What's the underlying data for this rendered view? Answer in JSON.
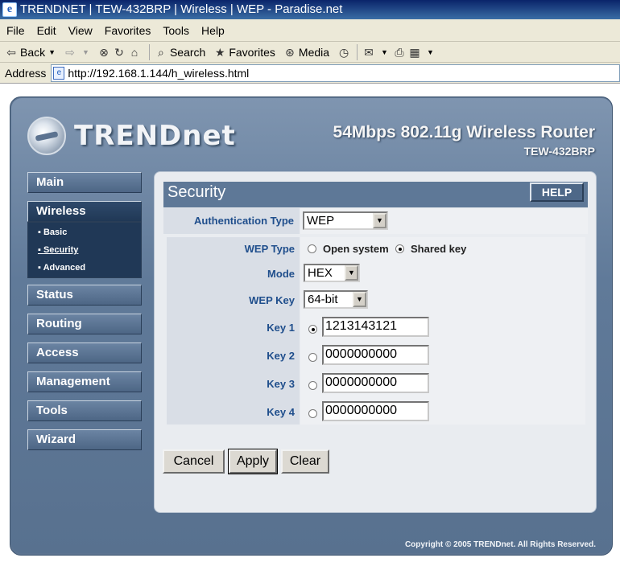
{
  "window": {
    "title": "TRENDNET | TEW-432BRP | Wireless | WEP - Paradise.net",
    "icon": "ie-icon"
  },
  "menu": [
    "File",
    "Edit",
    "View",
    "Favorites",
    "Tools",
    "Help"
  ],
  "toolbar": {
    "back_label": "Back",
    "search_label": "Search",
    "favorites_label": "Favorites",
    "media_label": "Media"
  },
  "address": {
    "label": "Address",
    "url": "http://192.168.1.144/h_wireless.html"
  },
  "header": {
    "brand": "TRENDnet",
    "product_title": "54Mbps 802.11g Wireless Router",
    "product_model": "TEW-432BRP"
  },
  "sidebar": {
    "items": [
      {
        "label": "Main"
      },
      {
        "label": "Wireless",
        "active": true
      },
      {
        "label": "Status"
      },
      {
        "label": "Routing"
      },
      {
        "label": "Access"
      },
      {
        "label": "Management"
      },
      {
        "label": "Tools"
      },
      {
        "label": "Wizard"
      }
    ],
    "wireless_sub": [
      {
        "label": "Basic"
      },
      {
        "label": "Security",
        "current": true
      },
      {
        "label": "Advanced"
      }
    ]
  },
  "panel": {
    "title": "Security",
    "help_label": "HELP",
    "auth_type": {
      "label": "Authentication Type",
      "value": "WEP"
    },
    "wep_type": {
      "label": "WEP Type",
      "options": [
        "Open system",
        "Shared key"
      ],
      "selected": "Shared key"
    },
    "mode": {
      "label": "Mode",
      "value": "HEX"
    },
    "wep_key": {
      "label": "WEP Key",
      "value": "64-bit"
    },
    "keys": [
      {
        "label": "Key 1",
        "value": "1213143121",
        "selected": true
      },
      {
        "label": "Key 2",
        "value": "0000000000",
        "selected": false
      },
      {
        "label": "Key 3",
        "value": "0000000000",
        "selected": false
      },
      {
        "label": "Key 4",
        "value": "0000000000",
        "selected": false
      }
    ],
    "buttons": {
      "cancel": "Cancel",
      "apply": "Apply",
      "clear": "Clear"
    }
  },
  "footer": {
    "copyright": "Copyright © 2005 TRENDnet. All Rights Reserved."
  }
}
